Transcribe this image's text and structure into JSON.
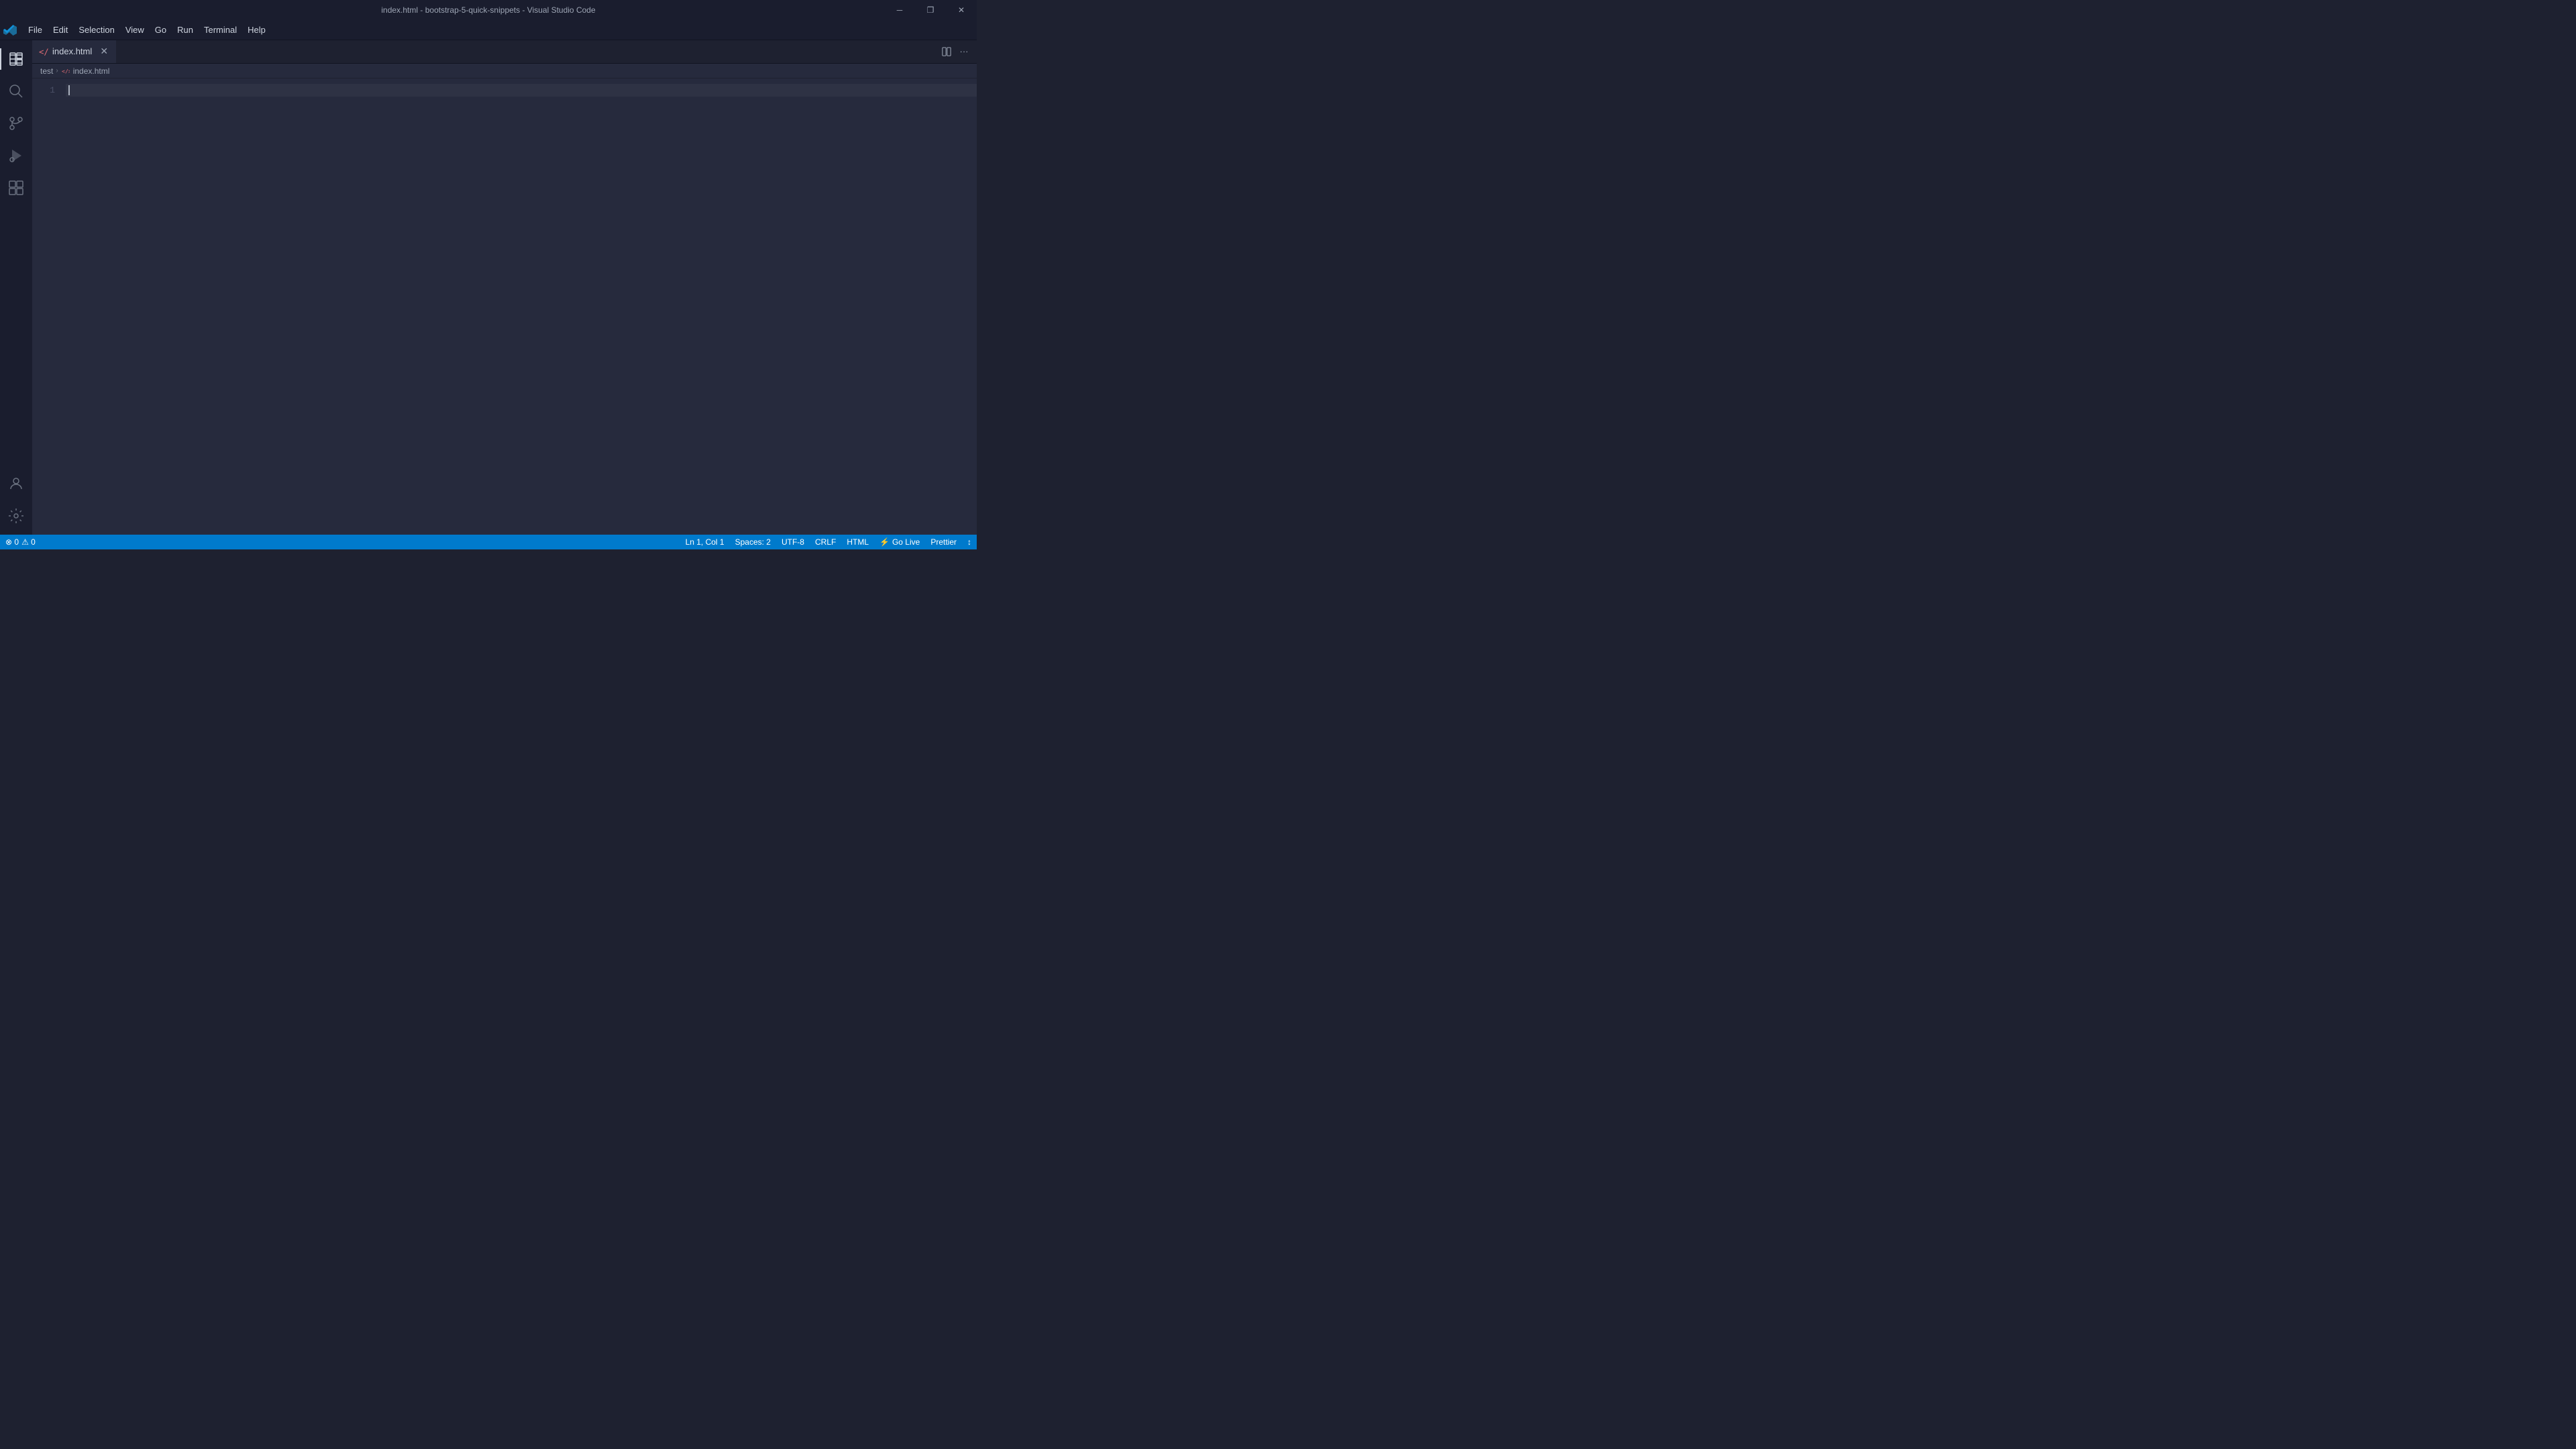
{
  "titleBar": {
    "title": "index.html - bootstrap-5-quick-snippets - Visual Studio Code"
  },
  "windowControls": {
    "minimize": "─",
    "restore": "❐",
    "close": "✕"
  },
  "menuBar": {
    "items": [
      {
        "label": "File"
      },
      {
        "label": "Edit"
      },
      {
        "label": "Selection"
      },
      {
        "label": "View"
      },
      {
        "label": "Go"
      },
      {
        "label": "Run"
      },
      {
        "label": "Terminal"
      },
      {
        "label": "Help"
      }
    ]
  },
  "activityBar": {
    "icons": [
      {
        "name": "explorer-icon",
        "glyph": "files",
        "active": true
      },
      {
        "name": "search-icon",
        "glyph": "search",
        "active": false
      },
      {
        "name": "source-control-icon",
        "glyph": "source-control",
        "active": false
      },
      {
        "name": "run-icon",
        "glyph": "run",
        "active": false
      },
      {
        "name": "extensions-icon",
        "glyph": "extensions",
        "active": false
      }
    ],
    "bottomIcons": [
      {
        "name": "account-icon",
        "glyph": "account"
      },
      {
        "name": "settings-icon",
        "glyph": "settings"
      }
    ]
  },
  "tabs": [
    {
      "label": "index.html",
      "active": true,
      "modified": false
    }
  ],
  "breadcrumb": {
    "folder": "test",
    "file": "index.html"
  },
  "editor": {
    "lineNumbers": [
      1
    ],
    "currentLine": 1,
    "currentCol": 1
  },
  "statusBar": {
    "errors": "⊗ 0",
    "warnings": "⚠ 0",
    "position": "Ln 1, Col 1",
    "spaces": "Spaces: 2",
    "encoding": "UTF-8",
    "lineEnding": "CRLF",
    "language": "HTML",
    "goLive": "Go Live",
    "prettier": "Prettier",
    "liveShare": "↕"
  }
}
